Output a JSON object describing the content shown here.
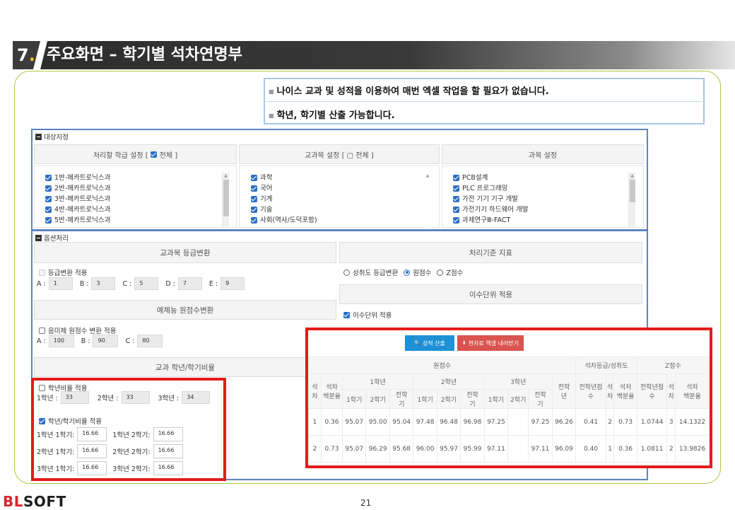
{
  "title": {
    "number": "7",
    "dot": ".",
    "text": "주요화면 –  학기별 석차연명부"
  },
  "callout": {
    "line1": "나이스 교과 및 성적을 이용하여 매번 엑셀 작업을 할 필요가 없습니다.",
    "line2": "학년, 학기별 산출 가능합니다."
  },
  "target": {
    "section_label": "대상지정",
    "col1_head_prefix": "처리할 학급 설정 [",
    "col1_head_check": "전체 ]",
    "col2_head": "교과목 설정 [ ▢ 전체 ]",
    "col3_head": "과목 설정",
    "classes": [
      "1반-메카트로닉스과",
      "2반-메카트로닉스과",
      "3반-메카트로닉스과",
      "4반-메카트로닉스과",
      "5반-메카트로닉스과"
    ],
    "subjects": [
      "과학",
      "국어",
      "기계",
      "기술",
      "사회(역사/도덕포함)"
    ],
    "courses": [
      "PCB설계",
      "PLC 프로그래밍",
      "가전 기기 기구 개발",
      "가전기기 하드웨어 개발",
      "과제연구Ⅲ-FACT"
    ]
  },
  "options": {
    "section_label": "옵션처리",
    "grade_convert_head": "교과목 등급변환",
    "grade_convert_label": "등급변환 적용",
    "grade_fields": [
      {
        "label": "A :",
        "value": "1"
      },
      {
        "label": "B :",
        "value": "3"
      },
      {
        "label": "C :",
        "value": "5"
      },
      {
        "label": "D :",
        "value": "7"
      },
      {
        "label": "E :",
        "value": "9"
      }
    ],
    "pe_head": "예체능 원점수변환",
    "pe_label": "음미체 원점수 변환 적용",
    "pe_fields": [
      {
        "label": "A :",
        "value": "100"
      },
      {
        "label": "B :",
        "value": "90"
      },
      {
        "label": "C :",
        "value": "80"
      }
    ],
    "ratio_head": "교과 학년/학기비율",
    "year_ratio_label": "학년비율 적용",
    "year_fields": [
      {
        "label": "1학년 :",
        "value": "33"
      },
      {
        "label": "2학년 :",
        "value": "33"
      },
      {
        "label": "3학년 :",
        "value": "34"
      }
    ],
    "term_ratio_label": "학년/학기비율 적용",
    "term_fields": [
      [
        {
          "label": "1학년 1학기:",
          "value": "16.66"
        },
        {
          "label": "1학년 2학기:",
          "value": "16.66"
        }
      ],
      [
        {
          "label": "2학년 1학기:",
          "value": "16.66"
        },
        {
          "label": "2학년 2학기:",
          "value": "16.66"
        }
      ],
      [
        {
          "label": "3학년 1학기:",
          "value": "16.66"
        },
        {
          "label": "3학년 2학기:",
          "value": "16.66"
        }
      ]
    ],
    "criteria_head": "처리기준 지표",
    "criteria_options": [
      "성취도 등급변환",
      "원점수",
      "Z점수"
    ],
    "criteria_selected": "원점수",
    "credit_head": "이수단위 적용",
    "credit_label": "이수단위 적용"
  },
  "results": {
    "btn_calc": "성적 산출",
    "btn_excel": "현자료 엑셀 내려받기",
    "btn_calc_color": "#1e90d6",
    "btn_excel_color": "#d9534f",
    "group_raw": "원점수",
    "group_rank": "석차등급/성취도",
    "group_z": "Z점수",
    "col_rank": "석\n차",
    "col_pct": "석차\n백분율",
    "years": [
      "1학년",
      "2학년",
      "3학년"
    ],
    "terms": [
      "1학기",
      "2학기",
      "전학\n기"
    ],
    "col_total": "전학\n년",
    "col_total_score": "전학년점\n수",
    "col_rank2": "석\n차",
    "col_pct2": "석차\n백분율",
    "col_z_total": "전학년점\n수",
    "col_z_rank": "석\n차",
    "col_z_pct": "석차\n백분율",
    "rows": [
      [
        "1",
        "0.36",
        "95.07",
        "95.00",
        "95.04",
        "97.48",
        "96.48",
        "96.98",
        "97.25",
        "",
        "97.25",
        "96.26",
        "0.41",
        "2",
        "0.73",
        "1.0744",
        "3",
        "14.1322"
      ],
      [
        "2",
        "0.73",
        "95.07",
        "96.29",
        "95.68",
        "96.00",
        "95.97",
        "95.99",
        "97.11",
        "",
        "97.11",
        "96.09",
        "0.40",
        "1",
        "0.36",
        "1.0811",
        "2",
        "13.9826"
      ]
    ]
  },
  "footer": {
    "logo_a": "BL",
    "logo_b": "SOFT",
    "page": "21"
  }
}
